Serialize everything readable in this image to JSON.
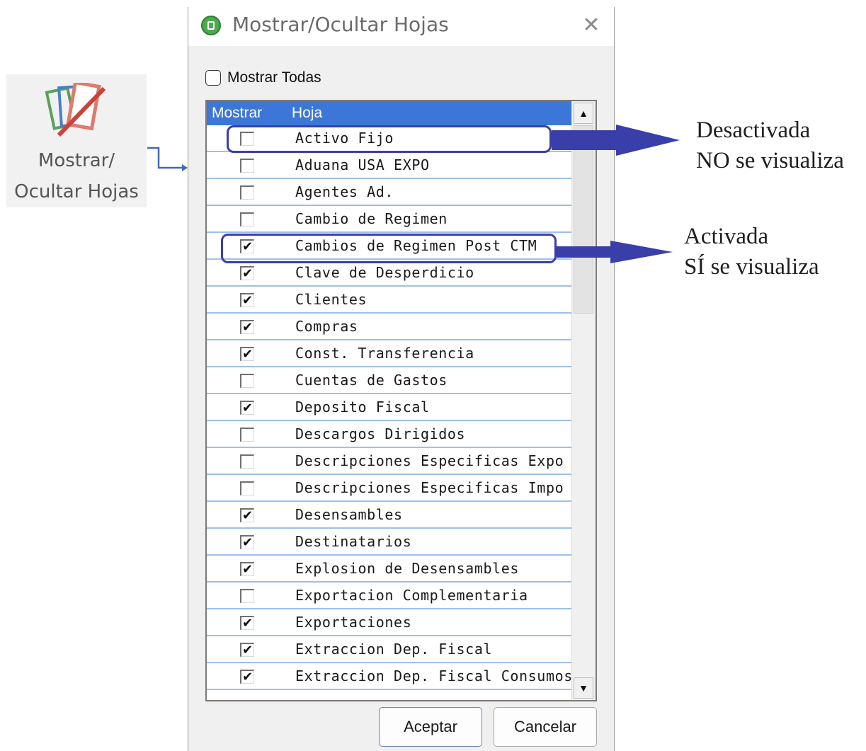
{
  "ribbon": {
    "label_line1": "Mostrar/",
    "label_line2": "Ocultar Hojas",
    "icon": "sheets-show-hide-icon"
  },
  "dialog": {
    "title": "Mostrar/Ocultar Hojas",
    "close_symbol": "✕",
    "show_all_label": "Mostrar Todas",
    "show_all_checked": false,
    "columns": {
      "show": "Mostrar",
      "sheet": "Hoja"
    },
    "rows": [
      {
        "label": "Activo Fijo",
        "checked": false,
        "mark": ""
      },
      {
        "label": "Aduana USA EXPO",
        "checked": false,
        "mark": ""
      },
      {
        "label": "Agentes Ad.",
        "checked": false,
        "mark": ""
      },
      {
        "label": "Cambio de Regimen",
        "checked": false,
        "mark": ""
      },
      {
        "label": "Cambios de Regimen Post CTM",
        "checked": true,
        "mark": "✔"
      },
      {
        "label": "Clave de Desperdicio",
        "checked": true,
        "mark": "✔"
      },
      {
        "label": "Clientes",
        "checked": true,
        "mark": "✔"
      },
      {
        "label": "Compras",
        "checked": true,
        "mark": "✔"
      },
      {
        "label": "Const. Transferencia",
        "checked": true,
        "mark": "✔"
      },
      {
        "label": "Cuentas de Gastos",
        "checked": false,
        "mark": ""
      },
      {
        "label": "Deposito Fiscal",
        "checked": true,
        "mark": "✔"
      },
      {
        "label": "Descargos Dirigidos",
        "checked": false,
        "mark": ""
      },
      {
        "label": "Descripciones Especificas Expo",
        "checked": false,
        "mark": ""
      },
      {
        "label": "Descripciones Especificas Impo",
        "checked": false,
        "mark": ""
      },
      {
        "label": "Desensambles",
        "checked": true,
        "mark": "✔"
      },
      {
        "label": "Destinatarios",
        "checked": true,
        "mark": "✔"
      },
      {
        "label": "Explosion de Desensambles",
        "checked": true,
        "mark": "✔"
      },
      {
        "label": "Exportacion Complementaria",
        "checked": false,
        "mark": ""
      },
      {
        "label": "Exportaciones",
        "checked": true,
        "mark": "✔"
      },
      {
        "label": "Extraccion Dep. Fiscal",
        "checked": true,
        "mark": "✔"
      },
      {
        "label": "Extraccion Dep. Fiscal Consumos",
        "checked": true,
        "mark": "✔"
      }
    ],
    "accept_label": "Aceptar",
    "cancel_label": "Cancelar",
    "scroll_up_symbol": "▲",
    "scroll_down_symbol": "▼"
  },
  "annotations": {
    "disabled_line1": "Desactivada",
    "disabled_line2": "NO se visualiza",
    "enabled_line1": "Activada",
    "enabled_line2": "SÍ se visualiza",
    "highlight_color": "#3a3ea8"
  }
}
